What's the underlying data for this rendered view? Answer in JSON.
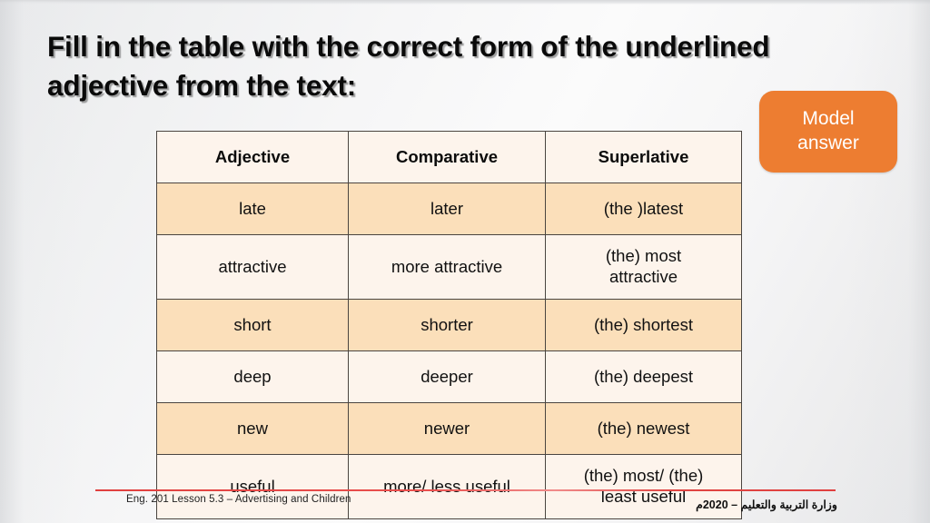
{
  "slide": {
    "title_lines": [
      "Fill in the table with the correct form of the underlined",
      "adjective from the text:"
    ],
    "badge": {
      "lines": [
        "Model",
        "answer"
      ],
      "color": "#ED7D31",
      "text_color": "#FFFFFF"
    },
    "colors": {
      "background": "#F4F4F5",
      "table_row_shade": "#FBDFBA",
      "table_row_plain": "#FDF4EC",
      "table_border": "#4A4540",
      "answer_red": "#E8241A",
      "answer_green": "#5F8A46",
      "adjective_black": "#141414",
      "footer_rule": "#E0403F"
    }
  },
  "table": {
    "headers": [
      "Adjective",
      "Comparative",
      "Superlative"
    ],
    "rows": [
      {
        "adjective": "late",
        "comparative": "later",
        "superlative": "(the )latest",
        "adjective_color": "red",
        "answer_color": "red",
        "shaded": true
      },
      {
        "adjective": "attractive",
        "comparative": "more attractive",
        "superlative": "(the) most\nattractive",
        "adjective_color": "dark",
        "answer_color": "green",
        "shaded": false
      },
      {
        "adjective": "short",
        "comparative": "shorter",
        "superlative": "(the) shortest",
        "adjective_color": "dark",
        "answer_color": "green",
        "shaded": true
      },
      {
        "adjective": "deep",
        "comparative": "deeper",
        "superlative": "(the)  deepest",
        "adjective_color": "dark",
        "answer_color": "green",
        "shaded": false
      },
      {
        "adjective": "new",
        "comparative": "newer",
        "superlative": "(the) newest",
        "adjective_color": "dark",
        "answer_color": "green",
        "shaded": true
      },
      {
        "adjective": "useful",
        "comparative": "more/ less useful",
        "superlative": "(the) most/ (the)\nleast useful",
        "adjective_color": "dark",
        "answer_color": "green",
        "shaded": false
      }
    ]
  },
  "footer": {
    "left_text": "Eng. 201 Lesson 5.3 – Advertising and Children",
    "right_text": "وزارة التربية والتعليم – 2020م"
  }
}
